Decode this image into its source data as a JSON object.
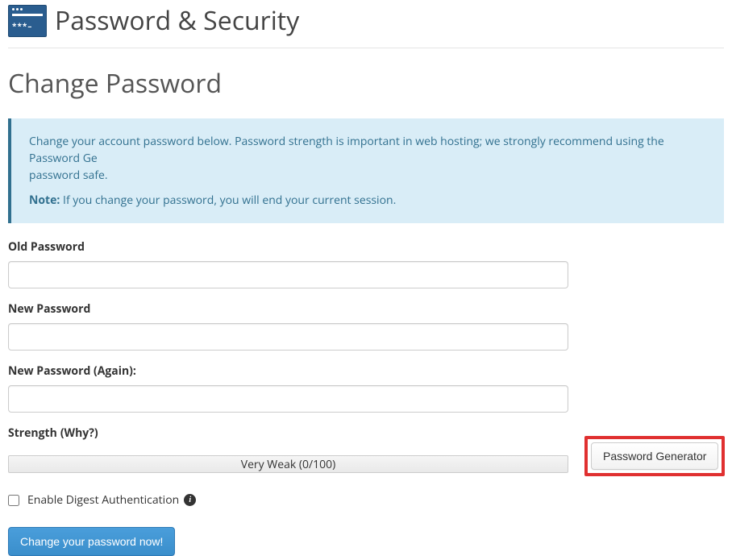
{
  "header": {
    "title": "Password & Security"
  },
  "section": {
    "title": "Change Password"
  },
  "alert": {
    "text1": "Change your account password below. Password strength is important in web hosting; we strongly recommend using the Password Ge",
    "text1_suffix": "password safe.",
    "note_label": "Note:",
    "note_text": " If you change your password, you will end your current session."
  },
  "form": {
    "old_password_label": "Old Password",
    "old_password_value": "",
    "new_password_label": "New Password",
    "new_password_value": "",
    "new_password_again_label": "New Password (Again):",
    "new_password_again_value": "",
    "strength_label": "Strength",
    "strength_why": "(Why?)",
    "strength_text": "Very Weak (0/100)",
    "generator_button": "Password Generator",
    "digest_label": "Enable Digest Authentication",
    "submit_button": "Change your password now!"
  }
}
